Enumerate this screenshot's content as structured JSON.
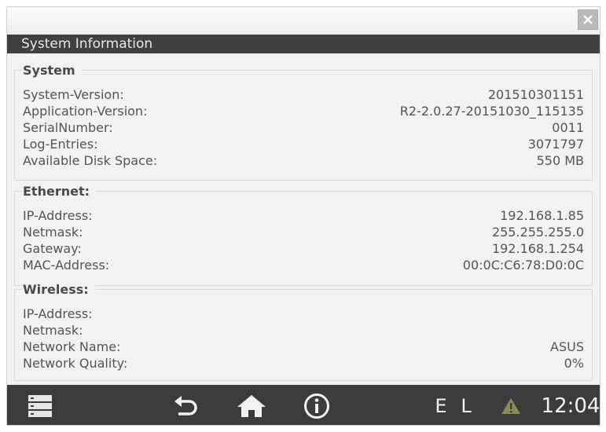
{
  "window": {
    "title": "System Information",
    "close_icon": "close-icon"
  },
  "system": {
    "heading": "System",
    "rows": [
      {
        "label": "System-Version:",
        "value": "201510301151"
      },
      {
        "label": "Application-Version:",
        "value": "R2-2.0.27-20151030_115135"
      },
      {
        "label": "SerialNumber:",
        "value": "0011"
      },
      {
        "label": "Log-Entries:",
        "value": "3071797"
      },
      {
        "label": "Available Disk Space:",
        "value": "550 MB"
      }
    ]
  },
  "ethernet": {
    "heading": "Ethernet:",
    "rows": [
      {
        "label": "IP-Address:",
        "value": "192.168.1.85"
      },
      {
        "label": "Netmask:",
        "value": "255.255.255.0"
      },
      {
        "label": "Gateway:",
        "value": "192.168.1.254"
      },
      {
        "label": "MAC-Address:",
        "value": "00:0C:C6:78:D0:0C"
      }
    ]
  },
  "wireless": {
    "heading": "Wireless:",
    "rows": [
      {
        "label": "IP-Address:",
        "value": ""
      },
      {
        "label": "Netmask:",
        "value": ""
      },
      {
        "label": "Network Name:",
        "value": "ASUS"
      },
      {
        "label": "Network Quality:",
        "value": "0%"
      }
    ]
  },
  "bottom_bar": {
    "icons": [
      "menu-icon",
      "back-icon",
      "home-icon",
      "info-icon",
      "warning-icon"
    ],
    "status_e": "E",
    "status_l": "L",
    "time": "12:04",
    "warning_color": "#8a8a5a"
  },
  "colors": {
    "title_bar": "#404040",
    "bottom_bar": "#3c3c3c",
    "panel_bg": "#f2f2f2"
  }
}
